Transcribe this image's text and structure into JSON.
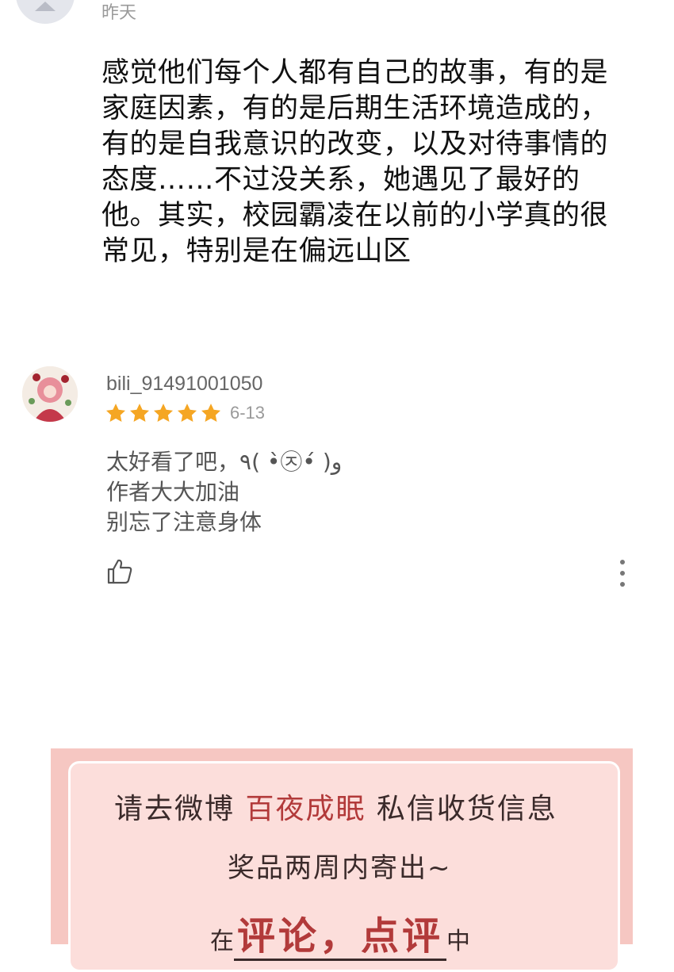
{
  "top_comment": {
    "time": "昨天",
    "text": "感觉他们每个人都有自己的故事，有的是家庭因素，有的是后期生活环境造成的，有的是自我意识的改变，以及对待事情的态度……不过没关系，她遇见了最好的他。其实，校园霸凌在以前的小学真的很常见，特别是在偏远山区"
  },
  "comment2": {
    "username": "bili_91491001050",
    "rating": 5,
    "date": "6-13",
    "lines": [
      "太好看了吧，٩( •̀㉨•́ )و",
      "作者大大加油",
      "别忘了注意身体"
    ],
    "icons": {
      "like": "thumbs-up-icon",
      "more": "more-vertical-icon",
      "star": "star-icon"
    }
  },
  "promo": {
    "line1_before": "请去微博 ",
    "line1_accent": "百夜成眠",
    "line1_after": " 私信收货信息",
    "line2": "奖品两周内寄出~",
    "line3_before": "在",
    "line3_accent": "评论，点评",
    "line3_after": "中"
  },
  "colors": {
    "star": "#f5a623",
    "promo_bg": "#f6c7c2",
    "promo_card": "#fcdedb",
    "promo_accent": "#b23a3a"
  }
}
